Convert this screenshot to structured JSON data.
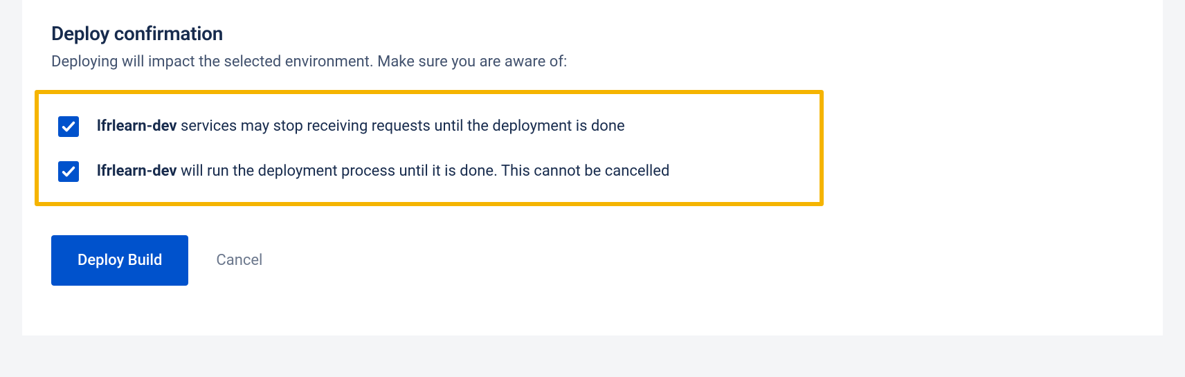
{
  "dialog": {
    "title": "Deploy confirmation",
    "description": "Deploying will impact the selected environment. Make sure you are aware of:"
  },
  "checkboxes": [
    {
      "env": "lfrlearn-dev",
      "text": " services may stop receiving requests until the deployment is done",
      "checked": true
    },
    {
      "env": "lfrlearn-dev",
      "text": " will run the deployment process until it is done. This cannot be cancelled",
      "checked": true
    }
  ],
  "buttons": {
    "primary": "Deploy Build",
    "secondary": "Cancel"
  }
}
